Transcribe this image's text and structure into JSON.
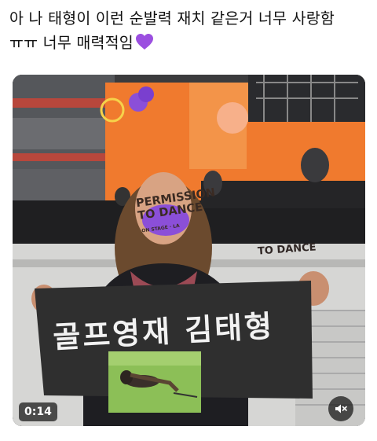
{
  "post": {
    "line1": "아 나  태형이 이런 순발력 재치 같은거 너무 사랑함",
    "line2": "ㅠㅠ 너무 매력적임",
    "emoji": "purple-heart-icon"
  },
  "video": {
    "sign_text": "골프영재 김태형",
    "stage_title": "PERMISSION TO DANCE",
    "stage_subtitle": "ON STAGE · LA",
    "stage_dance": "TO DANCE",
    "timestamp": "0:14",
    "mute_icon": "volume-muted-icon"
  },
  "colors": {
    "stage_orange": "#f07a2e",
    "mask_purple": "#8b4fd8",
    "heart_purple": "#9b4fe0",
    "sign_dark": "#2f2f2f"
  }
}
